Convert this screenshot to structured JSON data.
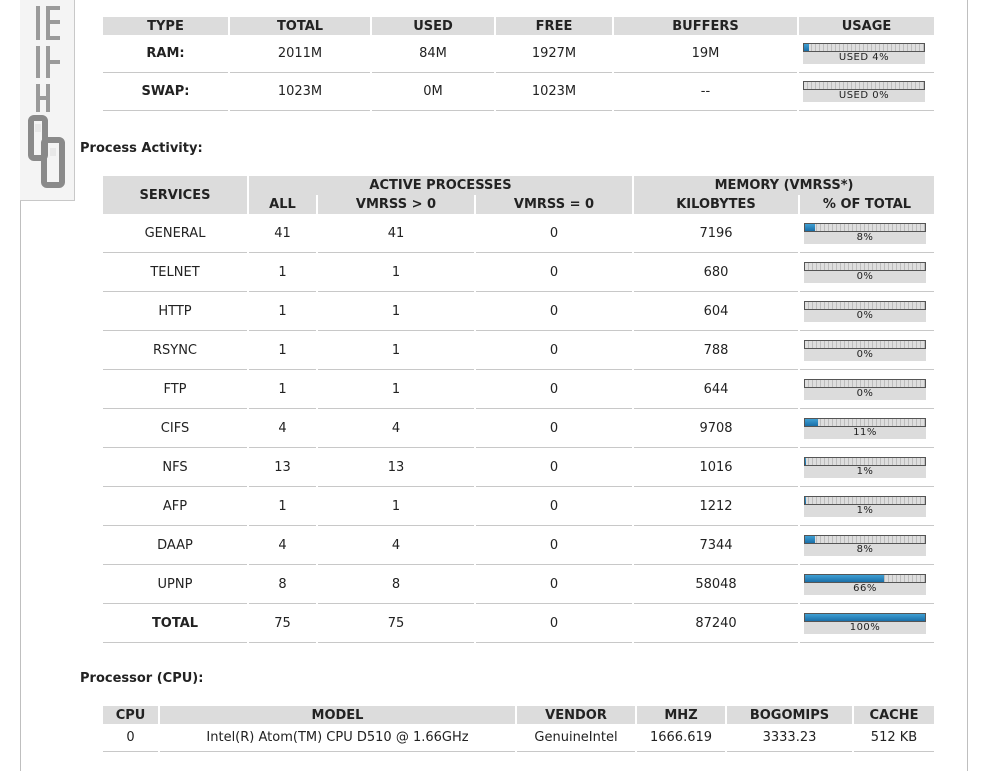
{
  "memory": {
    "headers": [
      "TYPE",
      "TOTAL",
      "USED",
      "FREE",
      "BUFFERS",
      "USAGE"
    ],
    "rows": [
      {
        "type": "RAM:",
        "total": "2011M",
        "used": "84M",
        "free": "1927M",
        "buffers": "19M",
        "usage_label": "USED 4%",
        "usage_pct": 4
      },
      {
        "type": "SWAP:",
        "total": "1023M",
        "used": "0M",
        "free": "1023M",
        "buffers": "--",
        "usage_label": "USED 0%",
        "usage_pct": 0
      }
    ]
  },
  "process": {
    "title": "Process Activity:",
    "h_services": "SERVICES",
    "h_active": "ACTIVE PROCESSES",
    "h_memory": "MEMORY (VMRSS*)",
    "h_all": "ALL",
    "h_vmrss_gt": "VMRSS > 0",
    "h_vmrss_eq": "VMRSS = 0",
    "h_kilobytes": "KILOBYTES",
    "h_pct_total": "% OF TOTAL",
    "rows": [
      {
        "service": "GENERAL",
        "all": "41",
        "gt": "41",
        "eq": "0",
        "kb": "7196",
        "pct_label": "8%",
        "pct": 8
      },
      {
        "service": "TELNET",
        "all": "1",
        "gt": "1",
        "eq": "0",
        "kb": "680",
        "pct_label": "0%",
        "pct": 0
      },
      {
        "service": "HTTP",
        "all": "1",
        "gt": "1",
        "eq": "0",
        "kb": "604",
        "pct_label": "0%",
        "pct": 0
      },
      {
        "service": "RSYNC",
        "all": "1",
        "gt": "1",
        "eq": "0",
        "kb": "788",
        "pct_label": "0%",
        "pct": 0
      },
      {
        "service": "FTP",
        "all": "1",
        "gt": "1",
        "eq": "0",
        "kb": "644",
        "pct_label": "0%",
        "pct": 0
      },
      {
        "service": "CIFS",
        "all": "4",
        "gt": "4",
        "eq": "0",
        "kb": "9708",
        "pct_label": "11%",
        "pct": 11
      },
      {
        "service": "NFS",
        "all": "13",
        "gt": "13",
        "eq": "0",
        "kb": "1016",
        "pct_label": "1%",
        "pct": 1
      },
      {
        "service": "AFP",
        "all": "1",
        "gt": "1",
        "eq": "0",
        "kb": "1212",
        "pct_label": "1%",
        "pct": 1
      },
      {
        "service": "DAAP",
        "all": "4",
        "gt": "4",
        "eq": "0",
        "kb": "7344",
        "pct_label": "8%",
        "pct": 8
      },
      {
        "service": "UPNP",
        "all": "8",
        "gt": "8",
        "eq": "0",
        "kb": "58048",
        "pct_label": "66%",
        "pct": 66
      },
      {
        "service": "TOTAL",
        "all": "75",
        "gt": "75",
        "eq": "0",
        "kb": "87240",
        "pct_label": "100%",
        "pct": 100,
        "bold": true
      }
    ]
  },
  "cpu": {
    "title": "Processor (CPU):",
    "headers": [
      "CPU",
      "MODEL",
      "VENDOR",
      "MHZ",
      "BOGOMIPS",
      "CACHE"
    ],
    "rows": [
      {
        "cpu": "0",
        "model": "Intel(R) Atom(TM) CPU D510 @ 1.66GHz",
        "vendor": "GenuineIntel",
        "mhz": "1666.619",
        "bogomips": "3333.23",
        "cache": "512 KB"
      }
    ]
  },
  "colors": {
    "bar_fill": "#1e78b4",
    "header_bg": "#dcdcdc"
  },
  "sidebar": {
    "logo_icon": "iei-logo-icon"
  }
}
